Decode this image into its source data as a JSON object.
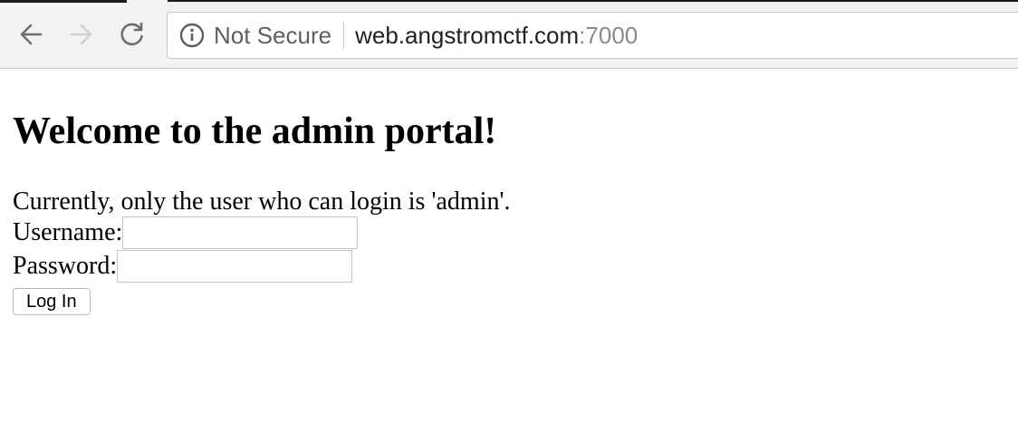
{
  "browser": {
    "security_label": "Not Secure",
    "url_host": "web.angstromctf.com",
    "url_port": ":7000"
  },
  "page": {
    "heading": "Welcome to the admin portal!",
    "notice": "Currently, only the user who can login is 'admin'.",
    "username_label": "Username:",
    "username_value": "",
    "password_label": "Password:",
    "password_value": "",
    "login_button": "Log In"
  }
}
